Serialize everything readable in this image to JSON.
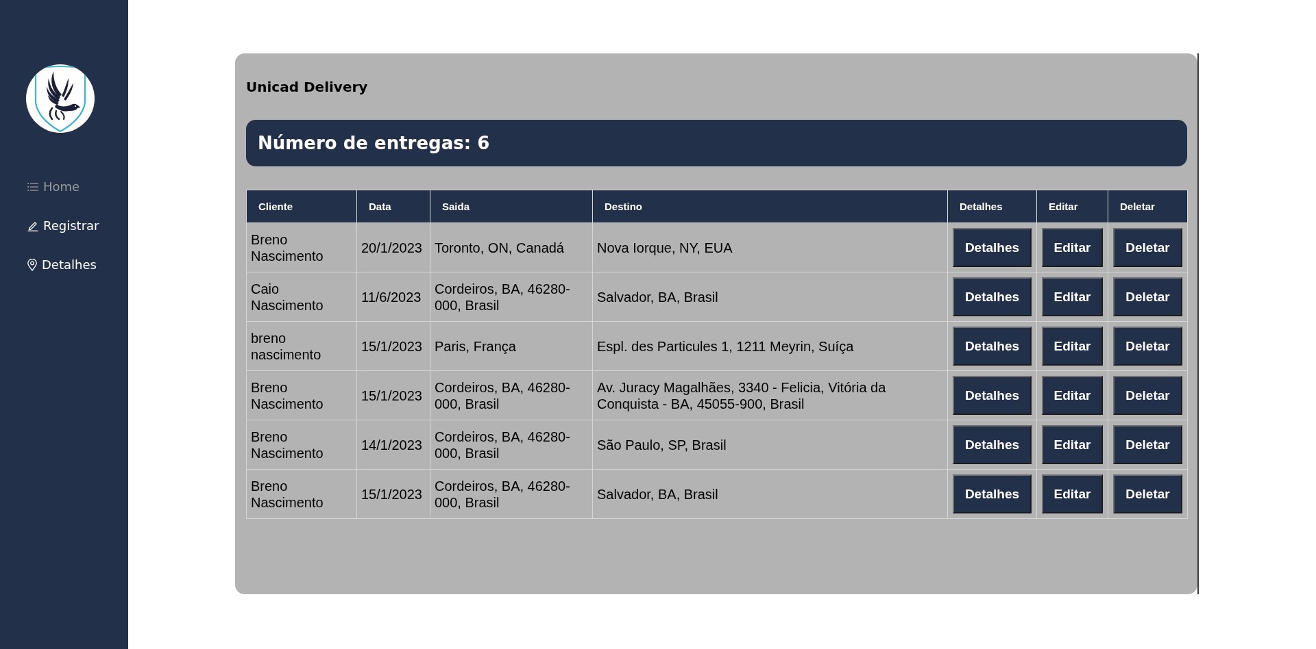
{
  "sidebar": {
    "items": [
      {
        "label": "Home",
        "selected": true
      },
      {
        "label": "Registrar",
        "selected": false
      },
      {
        "label": "Detalhes",
        "selected": false
      }
    ]
  },
  "main": {
    "title": "Unicad Delivery",
    "banner": "Número de entregas: 6",
    "table": {
      "columns": [
        "Cliente",
        "Data",
        "Saida",
        "Destino",
        "Detalhes",
        "Editar",
        "Deletar"
      ],
      "rows": [
        {
          "cells": [
            "Breno Nascimento",
            "20/1/2023",
            "Toronto, ON, Canadá",
            "Nova Iorque, NY, EUA"
          ],
          "actions": [
            "Detalhes",
            "Editar",
            "Deletar"
          ]
        },
        {
          "cells": [
            "Caio Nascimento",
            "11/6/2023",
            "Cordeiros, BA, 46280-000, Brasil",
            "Salvador, BA, Brasil"
          ],
          "actions": [
            "Detalhes",
            "Editar",
            "Deletar"
          ]
        },
        {
          "cells": [
            "breno nascimento",
            "15/1/2023",
            "Paris, França",
            "Espl. des Particules 1, 1211 Meyrin, Suíça"
          ],
          "actions": [
            "Detalhes",
            "Editar",
            "Deletar"
          ]
        },
        {
          "cells": [
            "Breno Nascimento",
            "15/1/2023",
            "Cordeiros, BA, 46280-000, Brasil",
            "Av. Juracy Magalhães, 3340 - Felicia, Vitória da Conquista - BA, 45055-900, Brasil"
          ],
          "actions": [
            "Detalhes",
            "Editar",
            "Deletar"
          ]
        },
        {
          "cells": [
            "Breno Nascimento",
            "14/1/2023",
            "Cordeiros, BA, 46280-000, Brasil",
            "São Paulo, SP, Brasil"
          ],
          "actions": [
            "Detalhes",
            "Editar",
            "Deletar"
          ]
        },
        {
          "cells": [
            "Breno Nascimento",
            "15/1/2023",
            "Cordeiros, BA, 46280-000, Brasil",
            "Salvador, BA, Brasil"
          ],
          "actions": [
            "Detalhes",
            "Editar",
            "Deletar"
          ]
        }
      ]
    }
  }
}
